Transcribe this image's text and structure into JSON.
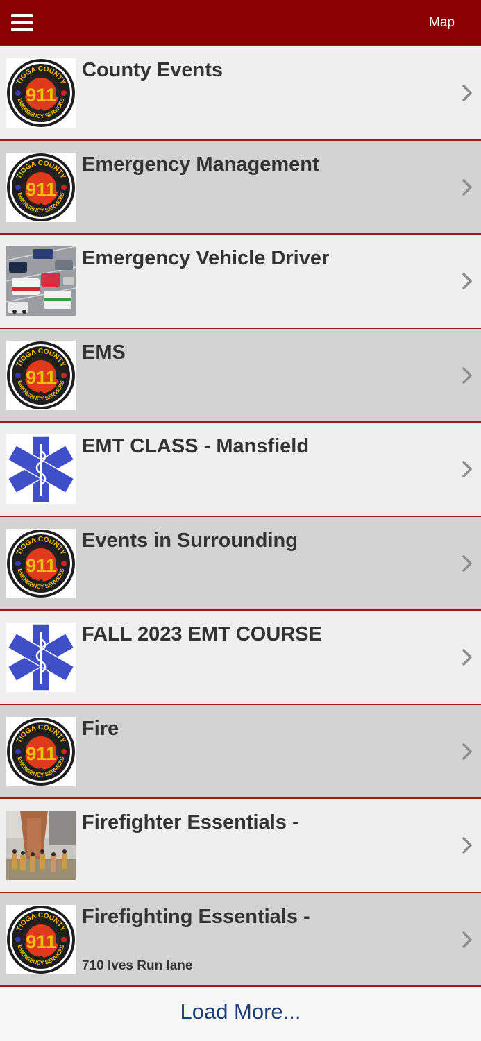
{
  "header": {
    "menu_icon": "hamburger-menu-icon",
    "map_label": "Map",
    "background_color": "#8b0000"
  },
  "items": [
    {
      "title": "County Events",
      "subtitle": "",
      "icon": "tioga-county-911-logo"
    },
    {
      "title": "Emergency Management",
      "subtitle": "",
      "icon": "tioga-county-911-logo"
    },
    {
      "title": "Emergency Vehicle Driver",
      "subtitle": "",
      "icon": "emergency-vehicles-photo"
    },
    {
      "title": "EMS",
      "subtitle": "",
      "icon": "tioga-county-911-logo"
    },
    {
      "title": "EMT CLASS - Mansfield",
      "subtitle": "",
      "icon": "star-of-life-icon"
    },
    {
      "title": "Events in Surrounding",
      "subtitle": "",
      "icon": "tioga-county-911-logo"
    },
    {
      "title": "FALL 2023 EMT COURSE",
      "subtitle": "",
      "icon": "star-of-life-icon"
    },
    {
      "title": "Fire",
      "subtitle": "",
      "icon": "tioga-county-911-logo"
    },
    {
      "title": "Firefighter Essentials -",
      "subtitle": "",
      "icon": "firefighter-training-photo"
    },
    {
      "title": "Firefighting Essentials -",
      "subtitle": "710 Ives Run lane",
      "icon": "tioga-county-911-logo"
    }
  ],
  "logo_text": {
    "top": "TIOGA COUNTY",
    "center": "911",
    "bottom": "EMERGENCY SERVICES"
  },
  "load_more": {
    "label": "Load More..."
  },
  "colors": {
    "row_light": "#efefef",
    "row_dark": "#d3d3d3",
    "divider": "#9e1b1b",
    "link_blue": "#1a3c78"
  }
}
